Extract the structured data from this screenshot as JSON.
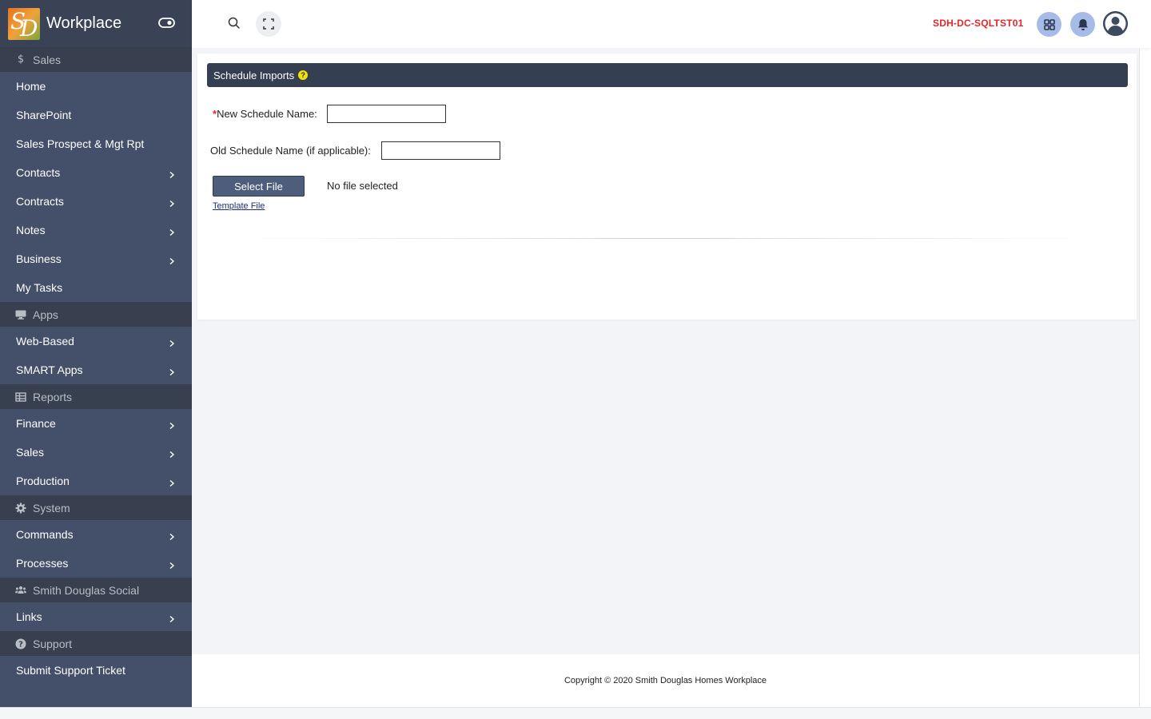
{
  "brand": {
    "title": "Workplace",
    "logo_text_1": "S",
    "logo_text_2": "D"
  },
  "sidebar": {
    "sections": [
      {
        "label": "Sales",
        "icon": "dollar-icon",
        "items": [
          {
            "label": "Home",
            "has_submenu": false
          },
          {
            "label": "SharePoint",
            "has_submenu": false
          },
          {
            "label": "Sales Prospect & Mgt Rpt",
            "has_submenu": false
          },
          {
            "label": "Contacts",
            "has_submenu": true
          },
          {
            "label": "Contracts",
            "has_submenu": true
          },
          {
            "label": "Notes",
            "has_submenu": true
          },
          {
            "label": "Business",
            "has_submenu": true
          },
          {
            "label": "My Tasks",
            "has_submenu": false
          }
        ]
      },
      {
        "label": "Apps",
        "icon": "desktop-icon",
        "items": [
          {
            "label": "Web-Based",
            "has_submenu": true
          },
          {
            "label": "SMART Apps",
            "has_submenu": true
          }
        ]
      },
      {
        "label": "Reports",
        "icon": "table-icon",
        "items": [
          {
            "label": "Finance",
            "has_submenu": true
          },
          {
            "label": "Sales",
            "has_submenu": true
          },
          {
            "label": "Production",
            "has_submenu": true
          }
        ]
      },
      {
        "label": "System",
        "icon": "gear-icon",
        "items": [
          {
            "label": "Commands",
            "has_submenu": true
          },
          {
            "label": "Processes",
            "has_submenu": true
          }
        ]
      },
      {
        "label": "Smith Douglas Social",
        "icon": "users-icon",
        "items": [
          {
            "label": "Links",
            "has_submenu": true
          }
        ]
      },
      {
        "label": "Support",
        "icon": "question-icon",
        "items": [
          {
            "label": "Submit Support Ticket",
            "has_submenu": false
          }
        ]
      }
    ]
  },
  "topbar": {
    "server_name": "SDH-DC-SQLTST01",
    "icons": [
      "search-icon",
      "fullscreen-icon",
      "apps-grid-icon",
      "bell-icon",
      "user-icon"
    ],
    "colors": {
      "server_name": "#e4262b",
      "badge_circle": "#a6bce6"
    }
  },
  "form": {
    "header_title": "Schedule Imports",
    "help_glyph": "?",
    "new_schedule_required_mark": "*",
    "new_schedule_label": "New Schedule Name:",
    "new_schedule_value": "",
    "old_schedule_label": "Old Schedule Name (if applicable):",
    "old_schedule_value": "",
    "select_file_label": "Select File",
    "no_file_text": "No file selected",
    "template_link": "Template File"
  },
  "footer": {
    "copyright": "Copyright © 2020 Smith Douglas Homes Workplace"
  },
  "colors": {
    "sidebar_bg": "#445069",
    "section_bg": "#38404f",
    "header_bg": "#353f52",
    "accent_red": "#e4262b",
    "help_yellow": "#f3e300"
  }
}
